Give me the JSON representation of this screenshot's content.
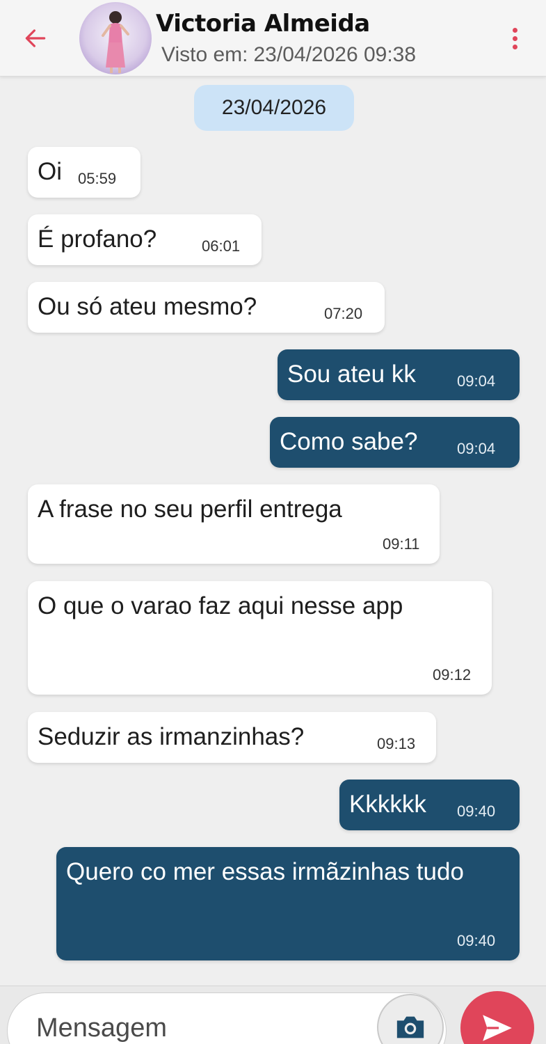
{
  "header": {
    "contact_name": "Victoria Almeida",
    "last_seen_prefix": "Visto em:",
    "last_seen_value": "23/04/2026 09:38"
  },
  "date_separator": "23/04/2026",
  "messages": [
    {
      "direction": "in",
      "text": "Oi",
      "time": "05:59"
    },
    {
      "direction": "in",
      "text": "É profano?",
      "time": "06:01"
    },
    {
      "direction": "in",
      "text": "Ou só ateu mesmo?",
      "time": "07:20"
    },
    {
      "direction": "out",
      "text": "Sou ateu kk",
      "time": "09:04"
    },
    {
      "direction": "out",
      "text": "Como sabe?",
      "time": "09:04"
    },
    {
      "direction": "in",
      "text": "A frase no seu perfil entrega",
      "time": "09:11"
    },
    {
      "direction": "in",
      "text": "O que o varao faz aqui nesse app",
      "time": "09:12"
    },
    {
      "direction": "in",
      "text": "Seduzir as irmanzinhas?",
      "time": "09:13"
    },
    {
      "direction": "out",
      "text": "Kkkkkk",
      "time": "09:40"
    },
    {
      "direction": "out",
      "text": "Quero co mer essas irmãzinhas tudo",
      "time": "09:40"
    }
  ],
  "input": {
    "placeholder": "Mensagem"
  },
  "icons": {
    "back": "arrow-left-icon",
    "menu": "more-vertical-icon",
    "camera": "camera-icon",
    "send": "send-icon"
  },
  "colors": {
    "accent": "#e0455a",
    "outgoing_bubble": "#1e4e6e",
    "incoming_bubble": "#ffffff",
    "date_chip": "#cce3f7",
    "background": "#efefef"
  }
}
